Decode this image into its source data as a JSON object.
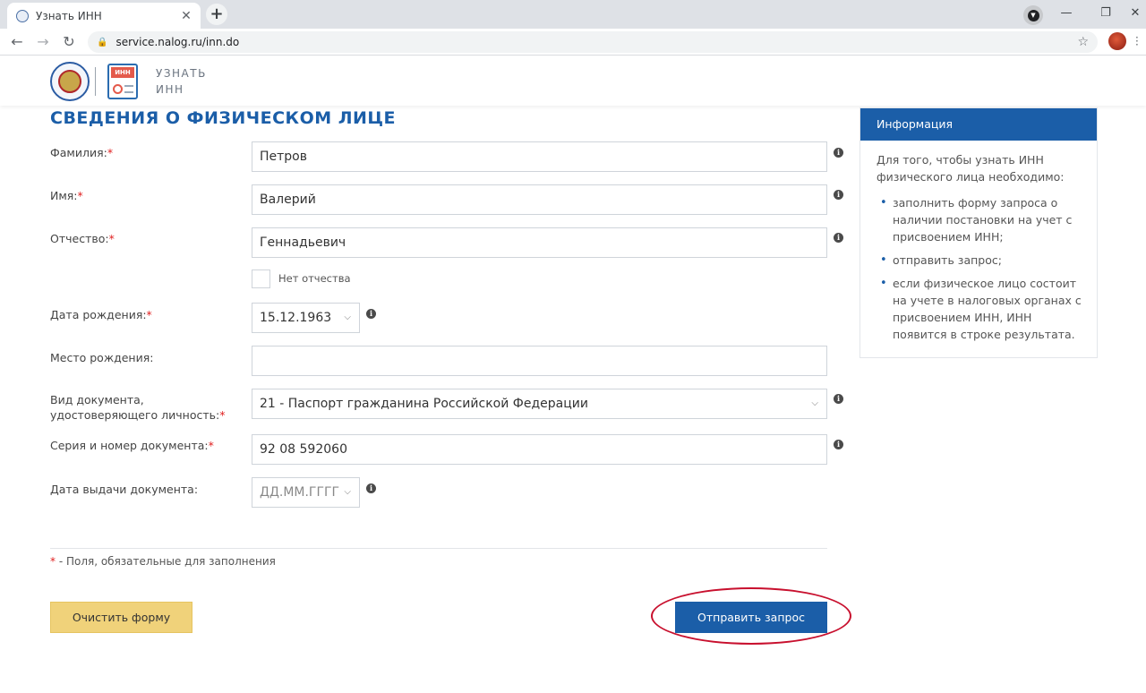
{
  "browser": {
    "tab_title": "Узнать ИНН",
    "tab_close": "✕",
    "new_tab": "+",
    "url": "service.nalog.ru/inn.do",
    "window": {
      "minimize": "—",
      "maximize": "❐",
      "close": "✕"
    }
  },
  "header": {
    "service_badge": "ИНН",
    "service_title_line1": "УЗНАТЬ",
    "service_title_line2": "ИНН"
  },
  "form": {
    "title": "СВЕДЕНИЯ О ФИЗИЧЕСКОМ ЛИЦЕ",
    "required_mark": "*",
    "surname": {
      "label": "Фамилия:",
      "value": "Петров"
    },
    "name": {
      "label": "Имя:",
      "value": "Валерий"
    },
    "patronymic": {
      "label": "Отчество:",
      "value": "Геннадьевич"
    },
    "no_patronymic": {
      "label": "Нет отчества",
      "checked": false
    },
    "birth_date": {
      "label": "Дата рождения:",
      "value": "15.12.1963"
    },
    "birth_place": {
      "label": "Место рождения:",
      "value": ""
    },
    "doc_type": {
      "label_line1": "Вид документа,",
      "label_line2": "удостоверяющего личность:",
      "value": "21 - Паспорт гражданина Российской Федерации"
    },
    "doc_number": {
      "label": "Серия и номер документа:",
      "value": "92 08 592060"
    },
    "doc_issue_date": {
      "label": "Дата выдачи документа:",
      "placeholder": "ДД.ММ.ГГГГ"
    },
    "required_note": " - Поля, обязательные для заполнения",
    "clear_button": "Очистить форму",
    "submit_button": "Отправить запрос"
  },
  "info_panel": {
    "title": "Информация",
    "intro": "Для того, чтобы узнать ИНН физического лица необходимо:",
    "items": [
      "заполнить форму запроса о наличии постановки на учет с присвоением ИНН;",
      "отправить запрос;",
      "если физическое лицо состоит на учете в налоговых органах с присвоением ИНН, ИНН появится в строке результата."
    ]
  },
  "colors": {
    "brand_blue": "#1b5ea8",
    "required_red": "#e02020",
    "clear_button": "#f0d27a",
    "highlight_ellipse": "#c8102e"
  },
  "icons": {
    "info": "i",
    "chevron": "⌵",
    "back": "←",
    "forward": "→",
    "reload": "↻",
    "lock": "🔒",
    "star": "☆"
  }
}
